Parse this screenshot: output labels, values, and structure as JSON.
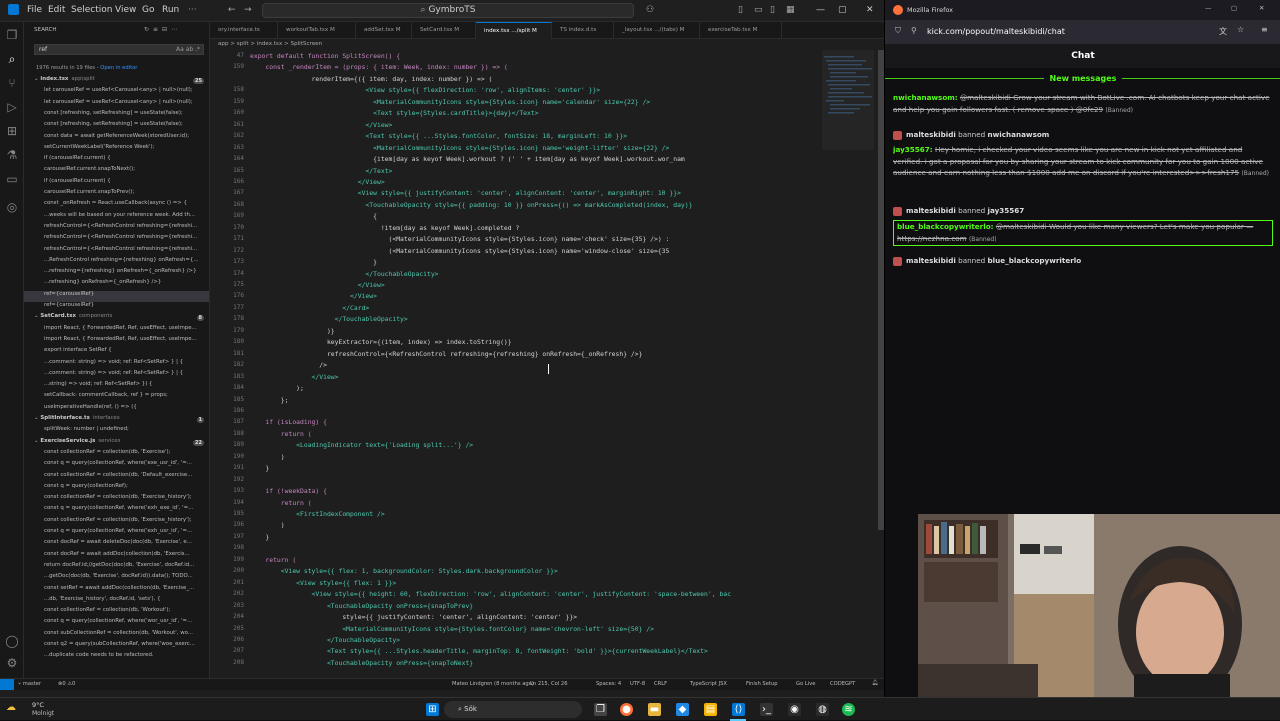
{
  "vscode": {
    "menu": [
      "File",
      "Edit",
      "Selection",
      "View",
      "Go",
      "Run"
    ],
    "command_center": "GymbroTS",
    "sidebar": {
      "title": "SEARCH",
      "query": "ref",
      "results_summary": "1976 results in 19 files",
      "open_in_editor": "Open in editor",
      "groups": [
        {
          "file": "index.tsx",
          "path": "app\\split",
          "count": "25",
          "lines": [
            "let carouselRef = useRef<Carousel<any> | null>(null);",
            "let carouselRef = useRef<Carousel<any> | null>(null);",
            "const [refreshing, setRefreshing] = useState(false);",
            "const [refreshing, setRefreshing] = useState(false);",
            "const data = await getReferenceWeek(storedUser.id);",
            "setCurrentWeekLabel('Reference Week');",
            "if (carouselRef.current) {",
            "carouselRef.current.snapToNext();",
            "if (carouselRef.current) {",
            "carouselRef.current.snapToPrev();",
            "const _onRefresh = React.useCallback(async () => {",
            "...weeks will be based on your reference week. Add th...",
            "refreshControl={<RefreshControl refreshing={refreshi...",
            "refreshControl={<RefreshControl refreshing={refreshi...",
            "refreshControl={<RefreshControl refreshing={refreshi...",
            "...RefreshControl refreshing={refreshing} onRefresh={...",
            "...refreshing={refreshing} onRefresh={_onRefresh} />}",
            "...refreshing} onRefresh={_onRefresh} />}",
            "ref={carouselRef}",
            "ref={carouselRef}"
          ]
        },
        {
          "file": "SetCard.tsx",
          "path": "components",
          "count": "8",
          "lines": [
            "import React, { ForwardedRef, Ref, useEffect, useImpe...",
            "import React, { ForwardedRef, Ref, useEffect, useImpe...",
            "export interface SetRef {",
            "...comment: string) => void; ref: Ref<SetRef> } | {",
            "...comment: string) => void; ref: Ref<SetRef> } | {",
            "...string) => void; ref: Ref<SetRef> }) {",
            "setCallback: commentCallback, ref } = props;",
            "useImperativeHandle(ref, () => ({"
          ]
        },
        {
          "file": "SplitInterface.ts",
          "path": "interfaces",
          "count": "1",
          "lines": [
            "splitWeek: number | undefined;"
          ]
        },
        {
          "file": "ExerciseService.js",
          "path": "services",
          "count": "22",
          "lines": [
            "const collectionRef = collection(db, 'Exercise');",
            "const q = query(collectionRef, where('exe_usr_id', '=...",
            "const collectionRef = collection(db, 'Default_exercise...",
            "const q = query(collectionRef);",
            "const collectionRef = collection(db, 'Exercise_history');",
            "const q = query(collectionRef, where('exh_exe_id', '=...",
            "const collectionRef = collection(db, 'Exercise_history');",
            "const q = query(collectionRef, where('exh_usr_id', '=...",
            "const docRef = await deleteDoc(doc(db, 'Exercise', e...",
            "const docRef = await addDoc(collection(db, 'Exercis...",
            "return docRef.id;//getDoc(doc(db, 'Exercise', docRef.id...",
            "...getDoc(doc(db, 'Exercise', docRef.id)).data(); TODO...",
            "const setRef = await addDoc(collection(db, 'Exercise_...",
            "...db, 'Exercise_history', docRef.id, 'sets'), {",
            "const collectionRef = collection(db, 'Workout');",
            "const q = query(collectionRef, where('wor_usr_id', '=...",
            "const subCollectionRef = collection(db, 'Workout', wo...",
            "const q2 = query(subCollectionRef, where('woe_exerc...",
            "...duplicate code needs to be refactored."
          ]
        }
      ]
    },
    "tabs": [
      "ory.interface.ts",
      "workoutTab.tsx M",
      "addSet.tsx M",
      "SetCard.tsx M",
      "index.tsx .../split M",
      "TS index.d.ts",
      "_layout.tsx .../(tabs) M",
      "exerciseTab.tsx M"
    ],
    "breadcrumb": "app > split > index.tsx > SplitScreen",
    "code_lines": [
      {
        "n": "47",
        "t": "export default function SplitScreen() {"
      },
      {
        "n": "159",
        "t": "    const _renderItem = (props: { item: Week, index: number }) => ("
      },
      {
        "n": "",
        "t": "                renderItem={({ item: day, index: number }) => ("
      },
      {
        "n": "158",
        "t": "                              <View style={{ flexDirection: 'row', alignItems: 'center' }}>"
      },
      {
        "n": "159",
        "t": "                                <MaterialCommunityIcons style={Styles.icon} name='calendar' size={22} />"
      },
      {
        "n": "160",
        "t": "                                <Text style={Styles.cardTitle}>{day}</Text>"
      },
      {
        "n": "161",
        "t": "                              </View>"
      },
      {
        "n": "162",
        "t": "                              <Text style={{ ...Styles.fontColor, fontSize: 18, marginLeft: 10 }}>"
      },
      {
        "n": "163",
        "t": "                                <MaterialCommunityIcons style={Styles.icon} name='weight-lifter' size={22} />"
      },
      {
        "n": "164",
        "t": "                                {item[day as keyof Week].workout ? (' ' + item[day as keyof Week].workout.wor_nam"
      },
      {
        "n": "165",
        "t": "                              </Text>"
      },
      {
        "n": "166",
        "t": "                            </View>"
      },
      {
        "n": "167",
        "t": "                            <View style={{ justifyContent: 'center', alignContent: 'center', marginRight: 10 }}>"
      },
      {
        "n": "168",
        "t": "                              <TouchableOpacity style={{ padding: 10 }} onPress={() => markAsCompleted(index, day)}"
      },
      {
        "n": "169",
        "t": "                                {"
      },
      {
        "n": "170",
        "t": "                                  !item[day as keyof Week].completed ?"
      },
      {
        "n": "171",
        "t": "                                    (<MaterialCommunityIcons style={Styles.icon} name='check' size={35} />) :"
      },
      {
        "n": "172",
        "t": "                                    (<MaterialCommunityIcons style={Styles.icon} name='window-close' size={35"
      },
      {
        "n": "173",
        "t": "                                }"
      },
      {
        "n": "174",
        "t": "                              </TouchableOpacity>"
      },
      {
        "n": "175",
        "t": "                            </View>"
      },
      {
        "n": "176",
        "t": "                          </View>"
      },
      {
        "n": "177",
        "t": "                        </Card>"
      },
      {
        "n": "178",
        "t": "                      </TouchableOpacity>"
      },
      {
        "n": "179",
        "t": "                    )}"
      },
      {
        "n": "180",
        "t": "                    keyExtractor={(item, index) => index.toString()}"
      },
      {
        "n": "181",
        "t": "                    refreshControl={<RefreshControl refreshing={refreshing} onRefresh={_onRefresh} />}"
      },
      {
        "n": "182",
        "t": "                  />"
      },
      {
        "n": "183",
        "t": "                </View>"
      },
      {
        "n": "184",
        "t": "            );"
      },
      {
        "n": "185",
        "t": "        };"
      },
      {
        "n": "186",
        "t": ""
      },
      {
        "n": "187",
        "t": "    if (isLoading) {"
      },
      {
        "n": "188",
        "t": "        return ("
      },
      {
        "n": "189",
        "t": "            <LoadingIndicator text={'Loading split...'} />"
      },
      {
        "n": "190",
        "t": "        )"
      },
      {
        "n": "191",
        "t": "    }"
      },
      {
        "n": "192",
        "t": ""
      },
      {
        "n": "193",
        "t": "    if (!weekData) {"
      },
      {
        "n": "194",
        "t": "        return ("
      },
      {
        "n": "195",
        "t": "            <FirstIndexComponent />"
      },
      {
        "n": "196",
        "t": "        )"
      },
      {
        "n": "197",
        "t": "    }"
      },
      {
        "n": "198",
        "t": ""
      },
      {
        "n": "199",
        "t": "    return ("
      },
      {
        "n": "200",
        "t": "        <View style={{ flex: 1, backgroundColor: Styles.dark.backgroundColor }}>"
      },
      {
        "n": "201",
        "t": "            <View style={{ flex: 1 }}>"
      },
      {
        "n": "202",
        "t": "                <View style={{ height: 60, flexDirection: 'row', alignContent: 'center', justifyContent: 'space-between', bac"
      },
      {
        "n": "203",
        "t": "                    <TouchableOpacity onPress={snapToPrev}"
      },
      {
        "n": "204",
        "t": "                        style={{ justifyContent: 'center', alignContent: 'center' }}>"
      },
      {
        "n": "205",
        "t": "                        <MaterialCommunityIcons style={Styles.fontColor} name='chevron-left' size={50} />"
      },
      {
        "n": "206",
        "t": "                    </TouchableOpacity>"
      },
      {
        "n": "207",
        "t": "                    <Text style={{ ...Styles.headerTitle, marginTop: 8, fontWeight: 'bold' }}>{currentWeekLabel}</Text>"
      },
      {
        "n": "208",
        "t": "                    <TouchableOpacity onPress={snapToNext}"
      }
    ],
    "status": {
      "branch": "master",
      "errors": "0",
      "warnings": "0",
      "blame": "Mateo Lindgren (8 months ago)",
      "cursor": "Ln 215, Col 26",
      "spaces": "Spaces: 4",
      "encoding": "UTF-8",
      "eol": "CRLF",
      "language": "TypeScript JSX",
      "finish": "Finish Setup",
      "golive": "Go Live",
      "codegpt": "CODEGPT"
    }
  },
  "firefox": {
    "window_title": "Mozilla Firefox",
    "url": "kick.com/popout/malteskibidi/chat",
    "chat_title": "Chat",
    "new_messages": "New messages",
    "messages": [
      {
        "type": "msg",
        "user": "nwichanawsom:",
        "text": "@malteskibidi Grow your stream with BotLive .com. AI chatbots keep your chat active and help you gain followers fast. ( remove space ) @0fc29",
        "note": "(Banned)"
      },
      {
        "type": "mod",
        "mod": "malteskibidi",
        "action": "banned",
        "target": "nwichanawsom"
      },
      {
        "type": "msg",
        "user": "jay35567:",
        "text": "Hey homie, i checked your video seems like you are new in kick not yet affiliated and verified. i got a proposal for you by sharing your stream to kick community for you to gain 1000 active audience and earn nothing less than $1000 add me on discord if you're interested>>>fresh175",
        "note": "(Banned)"
      },
      {
        "type": "mod",
        "mod": "malteskibidi",
        "action": "banned",
        "target": "jay35567"
      },
      {
        "type": "msg",
        "user": "blue_blackcopywriterlo:",
        "text": "@malteskibidi Would you like many viewers? Let's make you popular — https://nezhna.com",
        "note": "(Banned)"
      },
      {
        "type": "mod",
        "mod": "malteskibidi",
        "action": "banned",
        "target": "blue_blackcopywriterlo"
      }
    ]
  },
  "taskbar": {
    "weather_temp": "9°C",
    "weather_text": "Molnigt",
    "search": "Sök"
  },
  "colors": {
    "accent": "#0078d4",
    "kick_green": "#53fc18"
  }
}
